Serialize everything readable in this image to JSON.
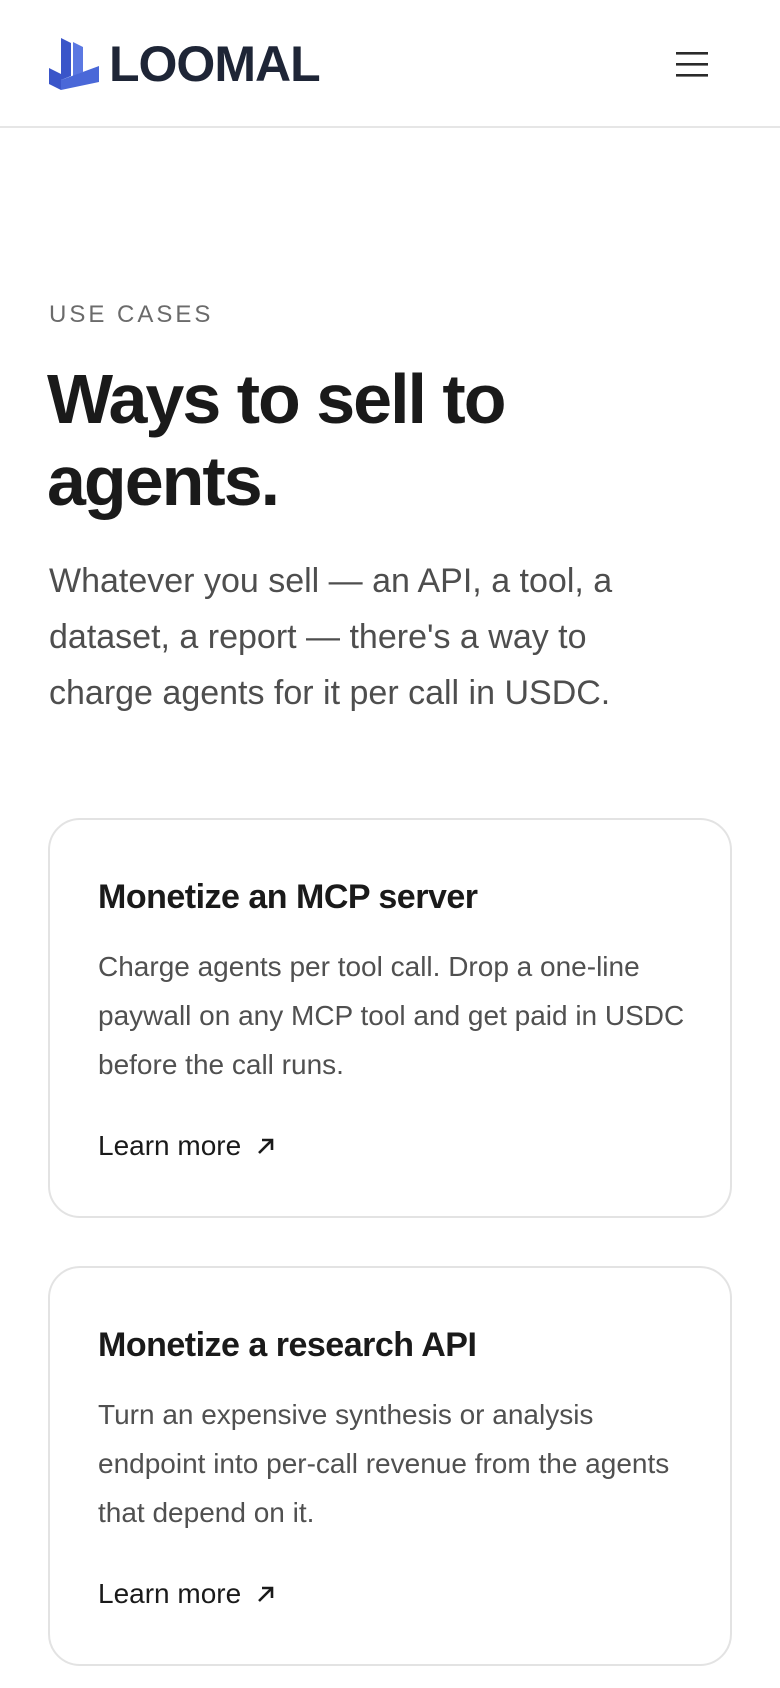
{
  "brand": {
    "name": "LOOMAL",
    "logo_icon": "loomal-logo-icon",
    "logo_color": "#4a68d8",
    "text_color": "#1e2536"
  },
  "header": {
    "menu_icon": "hamburger-menu-icon"
  },
  "hero": {
    "eyebrow": "USE CASES",
    "title": "Ways to sell to agents.",
    "intro": "Whatever you sell — an API, a tool, a dataset, a report — there's a way to charge agents for it per call in USDC."
  },
  "cards": [
    {
      "title": "Monetize an MCP server",
      "description": "Charge agents per tool call. Drop a one-line paywall on any MCP tool and get paid in USDC before the call runs.",
      "link_label": "Learn more",
      "link_icon": "arrow-up-right-icon"
    },
    {
      "title": "Monetize a research API",
      "description": "Turn an expensive synthesis or analysis endpoint into per-call revenue from the agents that depend on it.",
      "link_label": "Learn more",
      "link_icon": "arrow-up-right-icon"
    }
  ]
}
